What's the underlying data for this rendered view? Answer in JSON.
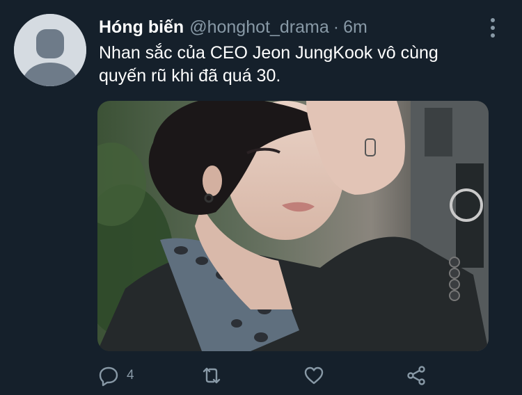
{
  "tweet": {
    "author_name": "Hóng biến",
    "handle": "@honghot_drama",
    "separator": "·",
    "time": "6m",
    "text": "Nhan sắc của CEO Jeon JungKook vô cùng quyến rũ khi đã quá 30.",
    "icons": {
      "avatar": "default-avatar-icon",
      "more": "more-vertical-icon",
      "reply": "reply-icon",
      "retweet": "retweet-icon",
      "like": "heart-icon",
      "share": "share-icon"
    },
    "actions": {
      "reply_count": "4"
    }
  },
  "theme": {
    "background": "#15202b",
    "secondary_text": "#8899a6",
    "primary_text": "#ffffff"
  }
}
